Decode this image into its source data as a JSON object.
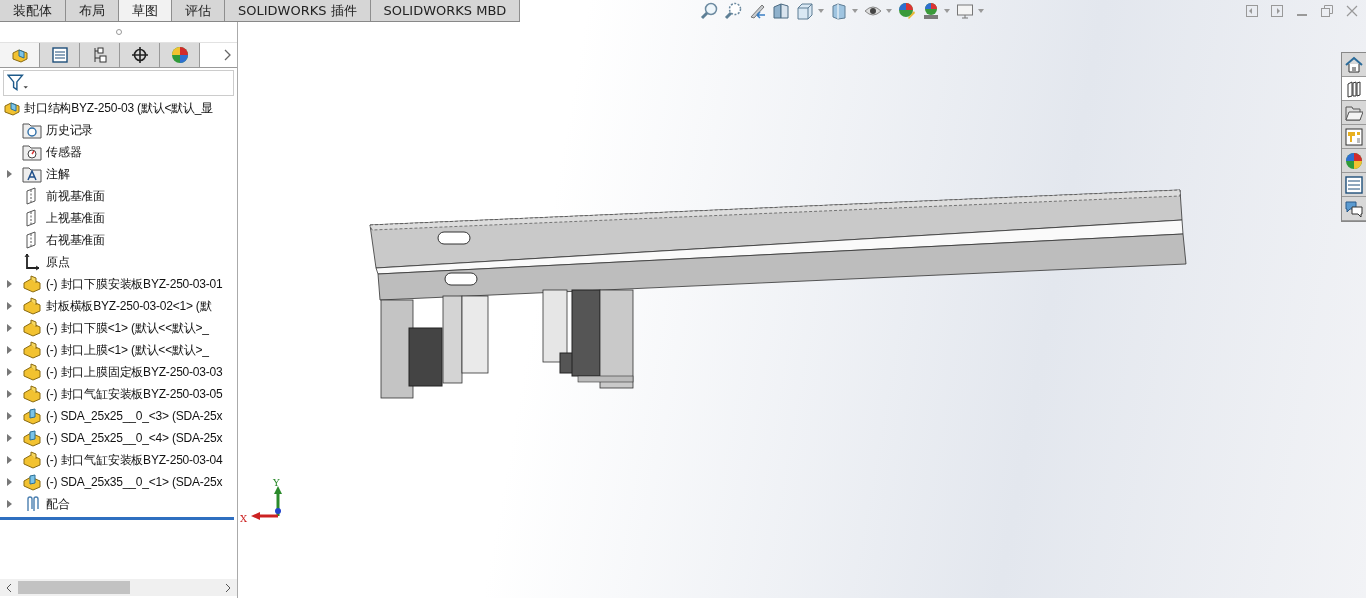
{
  "tabs": [
    {
      "label": "装配体",
      "selected": false
    },
    {
      "label": "布局",
      "selected": false
    },
    {
      "label": "草图",
      "selected": true
    },
    {
      "label": "评估",
      "selected": false
    },
    {
      "label": "SOLIDWORKS 插件",
      "selected": false
    },
    {
      "label": "SOLIDWORKS MBD",
      "selected": false
    }
  ],
  "panel_tabs": [
    {
      "kind": "feature",
      "selected": true
    },
    {
      "kind": "property",
      "selected": false
    },
    {
      "kind": "configuration",
      "selected": false
    },
    {
      "kind": "target",
      "selected": false
    },
    {
      "kind": "display",
      "selected": false
    }
  ],
  "tree": {
    "label": "封口结构BYZ-250-03  (默认<默认_显",
    "kind": "assembly",
    "children": [
      {
        "label": "历史记录",
        "kind": "history",
        "expandable": false
      },
      {
        "label": "传感器",
        "kind": "sensor",
        "expandable": false
      },
      {
        "label": "注解",
        "kind": "annotation",
        "expandable": true
      },
      {
        "label": "前视基准面",
        "kind": "plane",
        "expandable": false
      },
      {
        "label": "上视基准面",
        "kind": "plane",
        "expandable": false
      },
      {
        "label": "右视基准面",
        "kind": "plane",
        "expandable": false
      },
      {
        "label": "原点",
        "kind": "origin",
        "expandable": false
      },
      {
        "label": "(-) 封口下膜安装板BYZ-250-03-01",
        "kind": "part",
        "expandable": true
      },
      {
        "label": "封板横板BYZ-250-03-02<1> (默",
        "kind": "part",
        "expandable": true
      },
      {
        "label": "(-) 封口下膜<1> (默认<<默认>_",
        "kind": "part",
        "expandable": true
      },
      {
        "label": "(-) 封口上膜<1> (默认<<默认>_",
        "kind": "part",
        "expandable": true
      },
      {
        "label": "(-) 封口上膜固定板BYZ-250-03-03",
        "kind": "part",
        "expandable": true
      },
      {
        "label": "(-) 封口气缸安装板BYZ-250-03-05",
        "kind": "part",
        "expandable": true
      },
      {
        "label": "(-) SDA_25x25__0_<3> (SDA-25x",
        "kind": "toolbox",
        "expandable": true
      },
      {
        "label": "(-) SDA_25x25__0_<4> (SDA-25x",
        "kind": "toolbox",
        "expandable": true
      },
      {
        "label": "(-) 封口气缸安装板BYZ-250-03-04",
        "kind": "part",
        "expandable": true
      },
      {
        "label": "(-) SDA_25x35__0_<1> (SDA-25x",
        "kind": "toolbox",
        "expandable": true
      },
      {
        "label": "配合",
        "kind": "mates",
        "expandable": true
      }
    ]
  },
  "axes": {
    "x": "X",
    "y": "Y"
  },
  "task_pane": [
    {
      "kind": "home",
      "selected": false
    },
    {
      "kind": "library",
      "selected": true
    },
    {
      "kind": "folder",
      "selected": false
    },
    {
      "kind": "palette",
      "selected": false
    },
    {
      "kind": "appearance",
      "selected": false
    },
    {
      "kind": "properties",
      "selected": false
    },
    {
      "kind": "forum",
      "selected": false
    }
  ]
}
